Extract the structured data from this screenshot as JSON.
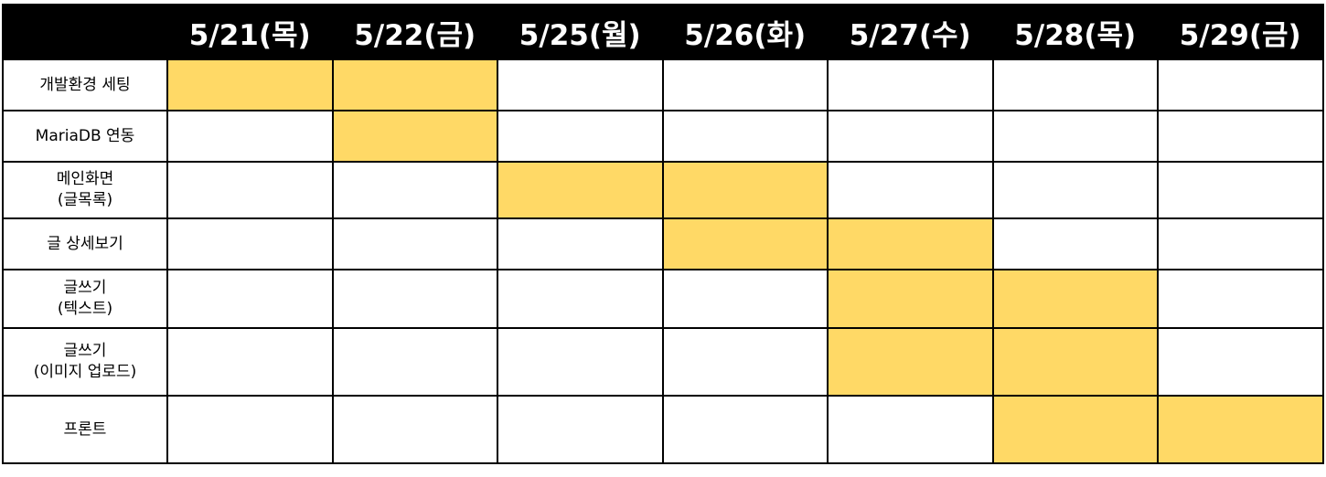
{
  "header": {
    "corner": "",
    "days": [
      "5/21(목)",
      "5/22(금)",
      "5/25(월)",
      "5/26(화)",
      "5/27(수)",
      "5/28(목)",
      "5/29(금)"
    ]
  },
  "tasks": [
    {
      "label": "개발환경 세팅",
      "active": [
        1,
        1,
        0,
        0,
        0,
        0,
        0
      ]
    },
    {
      "label": "MariaDB 연동",
      "active": [
        0,
        1,
        0,
        0,
        0,
        0,
        0
      ]
    },
    {
      "label": "메인화면\n(글목록)",
      "active": [
        0,
        0,
        1,
        1,
        0,
        0,
        0
      ]
    },
    {
      "label": "글 상세보기",
      "active": [
        0,
        0,
        0,
        1,
        1,
        0,
        0
      ]
    },
    {
      "label": "글쓰기\n(텍스트)",
      "active": [
        0,
        0,
        0,
        0,
        1,
        1,
        0
      ]
    },
    {
      "label": "글쓰기\n(이미지 업로드)",
      "active": [
        0,
        0,
        0,
        0,
        1,
        1,
        0
      ]
    },
    {
      "label": "프론트",
      "active": [
        0,
        0,
        0,
        0,
        0,
        1,
        1
      ]
    }
  ],
  "colors": {
    "header_bg": "#000000",
    "header_text": "#ffffff",
    "active_fill": "#FFD966",
    "grid": "#000000"
  }
}
